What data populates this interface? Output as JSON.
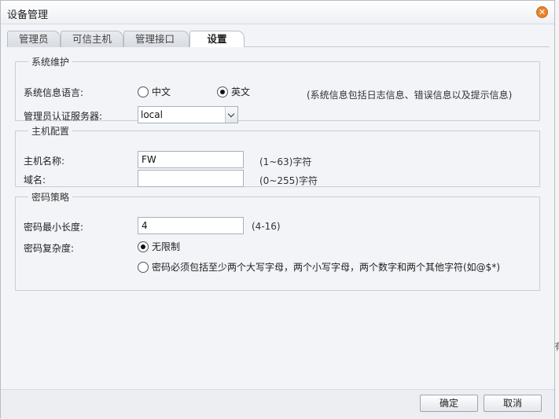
{
  "window": {
    "title": "设备管理"
  },
  "tabs": [
    {
      "label": "管理员"
    },
    {
      "label": "可信主机"
    },
    {
      "label": "管理接口"
    },
    {
      "label": "设置",
      "active": true
    }
  ],
  "system_maintenance": {
    "legend": "系统维护",
    "language_label": "系统信息语言:",
    "language_options": [
      "中文",
      "英文"
    ],
    "language_selected": "英文",
    "language_note": "(系统信息包括日志信息、错误信息以及提示信息)",
    "auth_server_label": "管理员认证服务器:",
    "auth_server_value": "local"
  },
  "host_config": {
    "legend": "主机配置",
    "hostname_label": "主机名称:",
    "hostname_value": "FW",
    "hostname_hint": "(1~63)字符",
    "domain_label": "域名:",
    "domain_value": "",
    "domain_hint": "(0~255)字符"
  },
  "password_policy": {
    "legend": "密码策略",
    "min_length_label": "密码最小长度:",
    "min_length_value": "4",
    "min_length_hint": "(4-16)",
    "complexity_label": "密码复杂度:",
    "complexity_options": [
      "无限制",
      "密码必须包括至少两个大写字母，两个小写字母，两个数字和两个其他字符(如@$*)"
    ],
    "complexity_selected": "无限制"
  },
  "footer": {
    "ok_label": "确定",
    "cancel_label": "取消"
  },
  "background": {
    "clipped_text": "有"
  },
  "colors": {
    "close_button": "#e8832a"
  }
}
